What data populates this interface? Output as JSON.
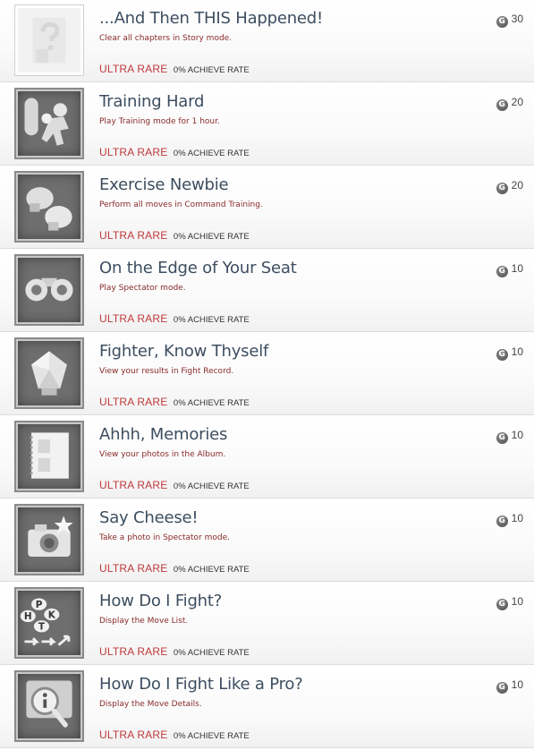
{
  "achievements": [
    {
      "title": "...And Then THIS Happened!",
      "description": "Clear all chapters in Story mode.",
      "rarity": "ULTRA RARE",
      "rate": "0% ACHIEVE RATE",
      "gamerscore": "30",
      "icon": "locked-secret-icon"
    },
    {
      "title": "Training Hard",
      "description": "Play Training mode for 1 hour.",
      "rarity": "ULTRA RARE",
      "rate": "0% ACHIEVE RATE",
      "gamerscore": "20",
      "icon": "punching-bag-fighter-icon"
    },
    {
      "title": "Exercise Newbie",
      "description": "Perform all moves in Command Training.",
      "rarity": "ULTRA RARE",
      "rate": "0% ACHIEVE RATE",
      "gamerscore": "20",
      "icon": "boxing-gloves-icon"
    },
    {
      "title": "On the Edge of Your Seat",
      "description": "Play Spectator mode.",
      "rarity": "ULTRA RARE",
      "rate": "0% ACHIEVE RATE",
      "gamerscore": "10",
      "icon": "binoculars-icon"
    },
    {
      "title": "Fighter, Know Thyself",
      "description": "View your results in Fight Record.",
      "rarity": "ULTRA RARE",
      "rate": "0% ACHIEVE RATE",
      "gamerscore": "10",
      "icon": "gem-icon"
    },
    {
      "title": "Ahhh, Memories",
      "description": "View your photos in the Album.",
      "rarity": "ULTRA RARE",
      "rate": "0% ACHIEVE RATE",
      "gamerscore": "10",
      "icon": "photo-album-icon"
    },
    {
      "title": "Say Cheese!",
      "description": "Take a photo in Spectator mode.",
      "rarity": "ULTRA RARE",
      "rate": "0% ACHIEVE RATE",
      "gamerscore": "10",
      "icon": "camera-icon"
    },
    {
      "title": "How Do I Fight?",
      "description": "Display the Move List.",
      "rarity": "ULTRA RARE",
      "rate": "0% ACHIEVE RATE",
      "gamerscore": "10",
      "icon": "move-buttons-icon"
    },
    {
      "title": "How Do I Fight Like a Pro?",
      "description": "Display the Move Details.",
      "rarity": "ULTRA RARE",
      "rate": "0% ACHIEVE RATE",
      "gamerscore": "10",
      "icon": "info-magnifier-icon"
    }
  ],
  "gamerscore_glyph": "G",
  "icons": {
    "move_buttons": [
      "P",
      "H",
      "K",
      "T"
    ]
  }
}
